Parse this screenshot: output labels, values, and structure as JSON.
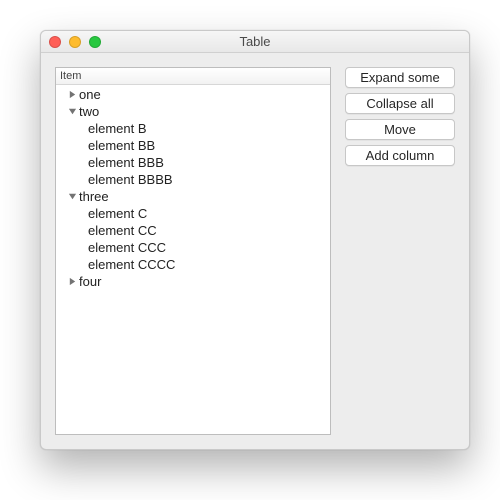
{
  "window": {
    "title": "Table"
  },
  "outline": {
    "header": "Item",
    "nodes": [
      {
        "label": "one",
        "expanded": false,
        "children": []
      },
      {
        "label": "two",
        "expanded": true,
        "children": [
          "element B",
          "element BB",
          "element BBB",
          "element BBBB"
        ]
      },
      {
        "label": "three",
        "expanded": true,
        "children": [
          "element C",
          "element CC",
          "element CCC",
          "element CCCC"
        ]
      },
      {
        "label": "four",
        "expanded": false,
        "children": []
      }
    ]
  },
  "buttons": {
    "expand_some": "Expand some",
    "collapse_all": "Collapse all",
    "move": "Move",
    "add_column": "Add column"
  }
}
